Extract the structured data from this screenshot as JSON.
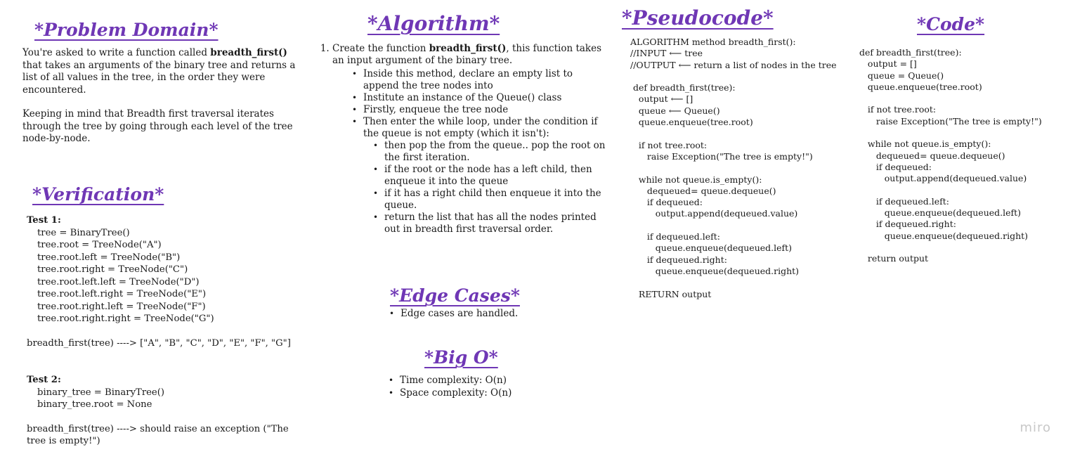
{
  "headings": {
    "problem_domain": "*Problem Domain*",
    "verification": "*Verification*",
    "algorithm": "*Algorithm*",
    "edge_cases": "*Edge Cases*",
    "big_o": "*Big O*",
    "pseudocode": "*Pseudocode*",
    "code": "*Code*"
  },
  "problem_domain": {
    "p1_before": "You're asked to write a function called ",
    "p1_bold": "breadth_first()",
    "p1_after": " that takes an arguments of the binary tree and returns a list of all values in the tree, in the order they were encountered.",
    "p2": "Keeping in mind that Breadth first traversal iterates through the tree by going through each level of the tree node-by-node."
  },
  "verification": {
    "test1_label": "Test 1:",
    "test1_lines": [
      "tree = BinaryTree()",
      "tree.root = TreeNode(\"A\")",
      "tree.root.left = TreeNode(\"B\")",
      "tree.root.right = TreeNode(\"C\")",
      "tree.root.left.left = TreeNode(\"D\")",
      "tree.root.left.right = TreeNode(\"E\")",
      "tree.root.right.left = TreeNode(\"F\")",
      "tree.root.right.right = TreeNode(\"G\")"
    ],
    "test1_result": "breadth_first(tree) ----> [\"A\", \"B\", \"C\", \"D\", \"E\", \"F\", \"G\"]",
    "test2_label": "Test 2:",
    "test2_lines": [
      "binary_tree = BinaryTree()",
      "binary_tree.root = None"
    ],
    "test2_result": "breadth_first(tree) ----> should raise an exception (\"The tree is empty!\")"
  },
  "algorithm": {
    "step1_before": "Create the function ",
    "step1_bold": "breadth_first()",
    "step1_after": ", this function takes an input argument of the binary tree.",
    "sub": [
      "Inside this method, declare an empty list to append the tree nodes into",
      "Institute an instance of the Queue() class",
      "Firstly, enqueue the tree node",
      "Then enter the while loop, under the condition if the queue is not empty (which it isn't):"
    ],
    "subsub": [
      "then pop the from the queue.. pop the root on the first iteration.",
      "if the root or the node has a left child, then enqueue it into the queue",
      "if it has a right child then enqueue it into the queue.",
      "return the list that has all the nodes printed out in breadth first traversal order."
    ]
  },
  "edge_cases": {
    "items": [
      "Edge cases are handled."
    ]
  },
  "big_o": {
    "items": [
      "Time complexity: O(n)",
      "Space complexity: O(n)"
    ]
  },
  "pseudocode": {
    "lines": [
      "ALGORITHM method breadth_first():",
      "//INPUT ⟵ tree",
      "//OUTPUT ⟵ return a list of nodes in the tree",
      "",
      " def breadth_first(tree):",
      "   output ⟵ []",
      "   queue ⟵ Queue()",
      "   queue.enqueue(tree.root)",
      "",
      "   if not tree.root:",
      "      raise Exception(\"The tree is empty!\")",
      "",
      "   while not queue.is_empty():",
      "      dequeued= queue.dequeue()",
      "      if dequeued:",
      "         output.append(dequeued.value)",
      "",
      "      if dequeued.left:",
      "         queue.enqueue(dequeued.left)",
      "      if dequeued.right:",
      "         queue.enqueue(dequeued.right)",
      "",
      "   RETURN output"
    ]
  },
  "code": {
    "lines": [
      "def breadth_first(tree):",
      "   output = []",
      "   queue = Queue()",
      "   queue.enqueue(tree.root)",
      "",
      "   if not tree.root:",
      "      raise Exception(\"The tree is empty!\")",
      "",
      "   while not queue.is_empty():",
      "      dequeued= queue.dequeue()",
      "      if dequeued:",
      "         output.append(dequeued.value)",
      "",
      "      if dequeued.left:",
      "         queue.enqueue(dequeued.left)",
      "      if dequeued.right:",
      "         queue.enqueue(dequeued.right)",
      "",
      "   return output"
    ]
  },
  "watermark": "miro",
  "colors": {
    "heading": "#6f37b5",
    "text": "#1a1a1a",
    "watermark": "#c8c8c8"
  }
}
